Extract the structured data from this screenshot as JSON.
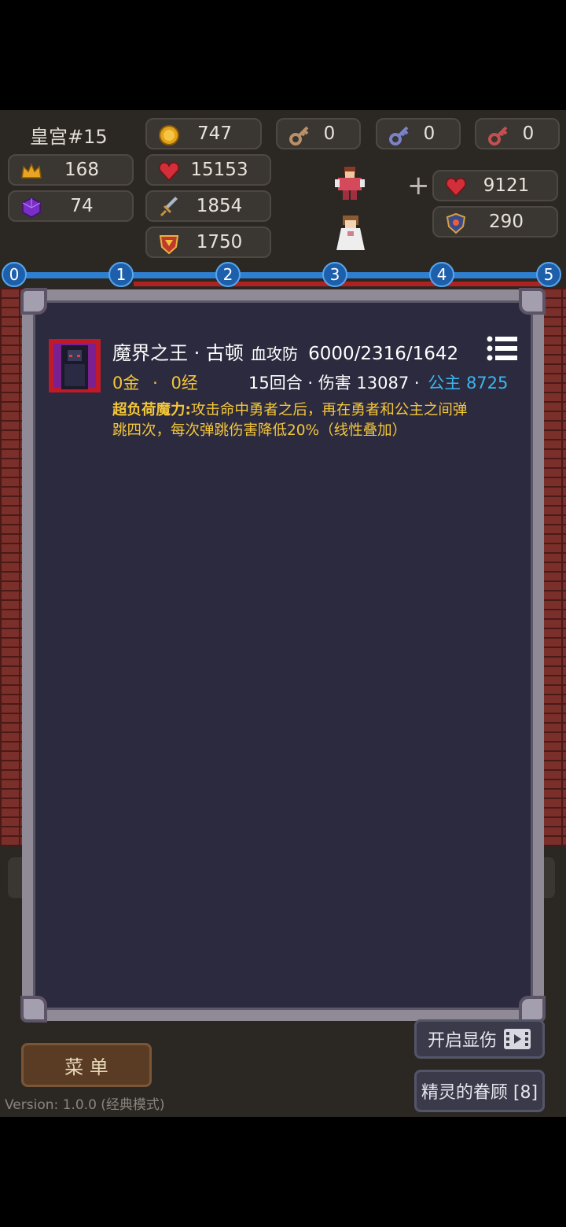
{
  "floor": {
    "label": "皇宫#15"
  },
  "stats": {
    "gold": "747",
    "key_yellow": "0",
    "key_blue": "0",
    "key_red": "0",
    "level": "168",
    "hp": "15153",
    "gem": "74",
    "attack": "1854",
    "defense": "1750"
  },
  "princess": {
    "plus": "+",
    "hp": "9121",
    "defense": "290"
  },
  "progress": {
    "nodes": [
      "0",
      "1",
      "2",
      "3",
      "4",
      "5"
    ]
  },
  "monster": {
    "name": "魔界之王 · 古顿",
    "stat_label": "血攻防",
    "stats": "6000/2316/1642",
    "gold": "0金",
    "sep": "·",
    "exp": "0经",
    "battle": "15回合 · 伤害 13087 ·",
    "princess_damage": "公主 8725",
    "skill_name": "超负荷魔力:",
    "skill_desc_line1": "攻击命中勇者之后，再在勇者和公主之间弹",
    "skill_desc_line2": "跳四次，每次弹跳伤害降低20%（线性叠加）"
  },
  "buttons": {
    "menu": "菜  单",
    "show_damage": "开启显伤",
    "fairy_blessing": "精灵的眷顾 [8]"
  },
  "version": "Version: 1.0.0 (经典模式)",
  "colors": {
    "accent_gold": "#f3c63a",
    "accent_blue": "#3ab6f0",
    "progress_blue": "#2e7fd0",
    "panel_bg": "#2c2a3e"
  }
}
